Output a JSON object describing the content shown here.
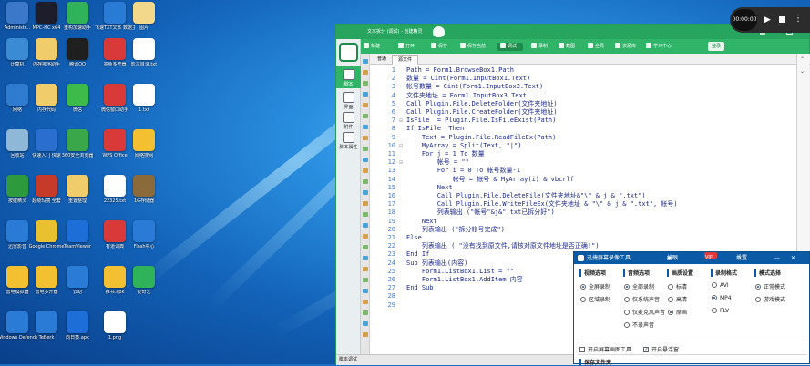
{
  "desktop": {
    "icons": [
      {
        "label": "Administr...",
        "color": "#3b78c9"
      },
      {
        "label": "MPC-HC x64",
        "color": "#1d1d2b"
      },
      {
        "label": "重构加速助手",
        "color": "#2fb25a"
      },
      {
        "label": "飞速TXT文本 数据主要工具",
        "color": "#2a7bd6"
      },
      {
        "label": "图片",
        "color": "#f2d88a"
      },
      {
        "label": "计算机",
        "color": "#3a8ad4"
      },
      {
        "label": "内存排序助手",
        "color": "#f0cc6a"
      },
      {
        "label": "腾讯QQ",
        "color": "#1f1f1f"
      },
      {
        "label": "墨鱼多开器",
        "color": "#d83a3a"
      },
      {
        "label": "影本目录.txt",
        "color": "#ffffff"
      },
      {
        "label": "网络",
        "color": "#2f7bd0"
      },
      {
        "label": "内存代码",
        "color": "#f0cc6a"
      },
      {
        "label": "微信",
        "color": "#3dbb4a"
      },
      {
        "label": "微信窗口助手",
        "color": "#d83a3a"
      },
      {
        "label": "1.txt",
        "color": "#ffffff"
      },
      {
        "label": "回收站",
        "color": "#8fb7d8"
      },
      {
        "label": "快速入门 快速",
        "color": "#2a6fcf"
      },
      {
        "label": "360安全浏览器",
        "color": "#3aa84a"
      },
      {
        "label": "WPS Office",
        "color": "#d83a3a"
      },
      {
        "label": "网络搜网",
        "color": "#f2c030"
      },
      {
        "label": "按键精灵",
        "color": "#2e9a3e"
      },
      {
        "label": "超级玛丽 全套",
        "color": "#c63a2a"
      },
      {
        "label": "重置整理",
        "color": "#f0cc6a"
      },
      {
        "label": "22325.txt",
        "color": "#ffffff"
      },
      {
        "label": "1G存储器",
        "color": "#8a6a3a"
      },
      {
        "label": "迅雷影音",
        "color": "#2a7bd6"
      },
      {
        "label": "Google Chrome",
        "color": "#e8c030"
      },
      {
        "label": "TeamViewer",
        "color": "#1d6ed6"
      },
      {
        "label": "有道词典",
        "color": "#d83a3a"
      },
      {
        "label": "Flash中心",
        "color": "#2a7bd6"
      },
      {
        "label": "雷电模拟器",
        "color": "#f2c030"
      },
      {
        "label": "雷电多开器",
        "color": "#f2c030"
      },
      {
        "label": "云助",
        "color": "#2a7bd6"
      },
      {
        "label": "推书.apk",
        "color": "#f2c030"
      },
      {
        "label": "爱奇艺",
        "color": "#2fb25a"
      },
      {
        "label": "Windows Defender",
        "color": "#2a7bd6"
      },
      {
        "label": "TeBerk",
        "color": "#2a7bd6"
      },
      {
        "label": "向日葵.apk",
        "color": "#1d6ed6"
      },
      {
        "label": "1.png",
        "color": "#ffffff"
      }
    ]
  },
  "window": {
    "title": "文本拆分 (调试) - 创建精灵",
    "toolbar": [
      "新建",
      "打开",
      "保存",
      "保存当前",
      "调试",
      "录制",
      "截图",
      "全局",
      "资源库",
      "学习中心"
    ],
    "toolbar_right": "登录",
    "left_nav": [
      "脚本",
      "界面",
      "附件",
      "脚本属性"
    ],
    "tabs": [
      "普通",
      "源文件"
    ],
    "line_numbers": [
      "1",
      "2",
      "3",
      "4",
      "5",
      "6",
      "7",
      "8",
      "9",
      "10",
      "11",
      "12",
      "13",
      "14",
      "15",
      "16",
      "17",
      "18",
      "19",
      "20",
      "21",
      "22",
      "23",
      "24",
      "25",
      "26",
      "27",
      "28",
      "29"
    ],
    "folds": [
      "",
      "",
      "",
      "",
      "",
      "",
      "⊟",
      "",
      "",
      "⊟",
      "",
      "⊟",
      "",
      "",
      "",
      "",
      "",
      "",
      "",
      "",
      "",
      "",
      "",
      "",
      "",
      "",
      "",
      "",
      ""
    ],
    "code": [
      "Path = Form1.BrowseBox1.Path",
      "数量 = Cint(Form1.InputBox1.Text)",
      "帐号数量 = Cint(Form1.InputBox2.Text)",
      "文件夹地址 = Form1.InputBox3.Text",
      "Call Plugin.File.DeleteFolder(文件夹地址)",
      "Call Plugin.File.CreateFolder(文件夹地址)",
      "IsFile  = Plugin.File.IsFileExist(Path)",
      "If IsFile  Then",
      "    Text = Plugin.File.ReadFileEx(Path)",
      "    MyArray = Split(Text, \"|\")",
      "    For j = 1 To 数量",
      "        帐号 = \"\"",
      "        For i = 0 To 帐号数量-1",
      "            帐号 = 帐号 & MyArray(i) & vbcrlf",
      "        Next",
      "        Call Plugin.File.DeleteFile(文件夹地址&\"\\\" & j & \".txt\")",
      "        Call Plugin.File.WriteFileEx(文件夹地址 & \"\\\" & j & \".txt\", 帐号)",
      "        列表输出 (\"帐号\"&j&\".txt已拆分好\")",
      "    Next",
      "    列表输出 (\"拆分帐号完成\")",
      "Else",
      "    列表输出 ( \"没有找到原文件,请核对原文件地址是否正确!\")",
      "End If",
      "Sub 列表输出(内容)",
      "    Form1.ListBox1.List = \"\"",
      "    Form1.ListBox1.AddItem 内容",
      "End Sub",
      "",
      ""
    ],
    "status_bar": "脚本调试"
  },
  "video": {
    "time": "00:00:00",
    "play": "▶",
    "menu": "⋮"
  },
  "recorder": {
    "title": "迅捷屏幕录像工具",
    "header_items": [
      "护眼",
      "VIP",
      "设置"
    ],
    "minimize": "—",
    "close": "✕",
    "sections": [
      {
        "label": "视频选项",
        "options": [
          {
            "text": "全屏录制",
            "on": true
          },
          {
            "text": "区域录制",
            "on": false
          }
        ]
      },
      {
        "label": "音频选项",
        "options": [
          {
            "text": "全部录制",
            "on": true
          },
          {
            "text": "仅系统声音",
            "on": false
          },
          {
            "text": "仅麦克风声音",
            "on": false
          },
          {
            "text": "不录声音",
            "on": false
          }
        ]
      },
      {
        "label": "画质设置",
        "options": [
          {
            "text": "标清",
            "on": false
          },
          {
            "text": "高清",
            "on": false
          },
          {
            "text": "原画",
            "on": true
          }
        ]
      },
      {
        "label": "录制格式",
        "options": [
          {
            "text": "AVI",
            "on": false
          },
          {
            "text": "MP4",
            "on": true
          },
          {
            "text": "FLV",
            "on": false
          }
        ]
      },
      {
        "label": "模式选择",
        "options": [
          {
            "text": "正常模式",
            "on": true
          },
          {
            "text": "游戏模式",
            "on": false
          }
        ]
      }
    ],
    "check1": {
      "text": "开启屏幕画图工具",
      "on": false
    },
    "check2": {
      "text": "开启悬浮窗",
      "on": true
    },
    "footer": "保存文件夹"
  }
}
